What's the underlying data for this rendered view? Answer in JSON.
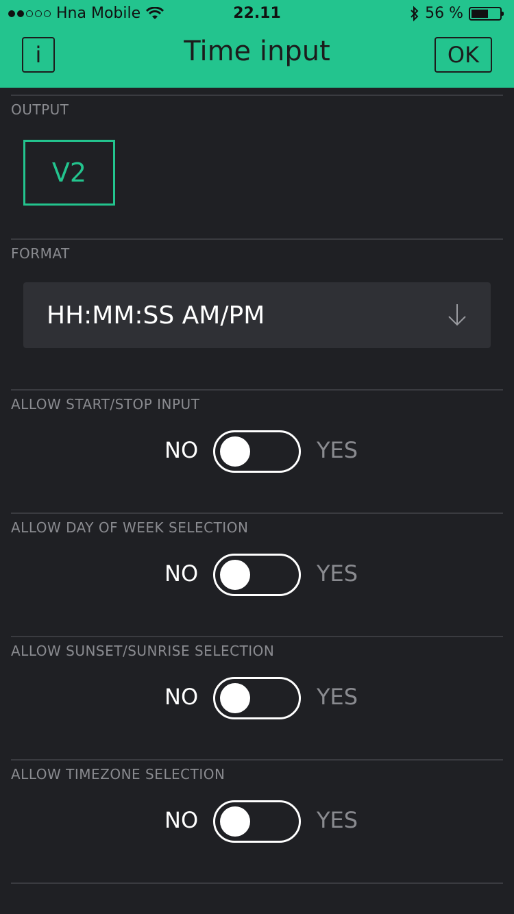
{
  "status_bar": {
    "carrier": "Hna Mobile",
    "time": "22.11",
    "battery": "56 %",
    "battery_level": 0.56
  },
  "header": {
    "title": "Time input",
    "info_label": "i",
    "ok_label": "OK"
  },
  "output": {
    "label": "OUTPUT",
    "pin": "V2"
  },
  "format": {
    "label": "FORMAT",
    "value": "HH:MM:SS AM/PM"
  },
  "switches": [
    {
      "label": "ALLOW START/STOP INPUT",
      "no": "NO",
      "yes": "YES",
      "on": false
    },
    {
      "label": "ALLOW DAY OF WEEK SELECTION",
      "no": "NO",
      "yes": "YES",
      "on": false
    },
    {
      "label": "ALLOW SUNSET/SUNRISE SELECTION",
      "no": "NO",
      "yes": "YES",
      "on": false
    },
    {
      "label": "ALLOW TIMEZONE SELECTION",
      "no": "NO",
      "yes": "YES",
      "on": false
    }
  ],
  "colors": {
    "accent": "#23c48e",
    "background": "#1f2024",
    "dropdown": "#2f3035"
  }
}
